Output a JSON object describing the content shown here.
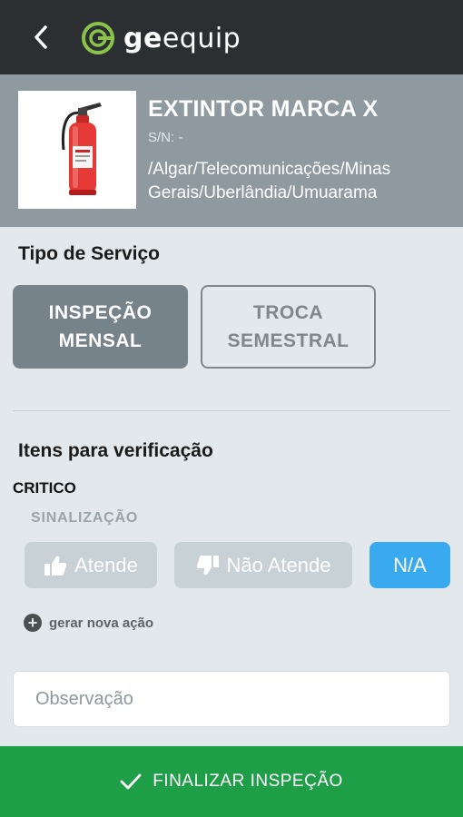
{
  "app": {
    "logo_prefix": "ge",
    "logo_suffix": "equip",
    "back_icon": "chevron-left-icon",
    "brand_color": "#8bc34a"
  },
  "equipment": {
    "name": "EXTINTOR MARCA X",
    "serial": "S/N: -",
    "path": "/Algar/Telecomunicações/Minas Gerais/Uberlândia/Umuarama",
    "image_icon": "fire-extinguisher-icon"
  },
  "service": {
    "title": "Tipo de Serviço",
    "options": [
      {
        "line1": "INSPEÇÃO",
        "line2": "MENSAL",
        "selected": true
      },
      {
        "line1": "TROCA",
        "line2": "SEMESTRAL",
        "selected": false
      }
    ]
  },
  "verification": {
    "title": "Itens para verificação",
    "group": "CRITICO",
    "item": "SINALIZAÇÃO",
    "answers": {
      "attend": "Atende",
      "not_attend": "Não Atende",
      "na": "N/A",
      "selected": "N/A"
    },
    "new_action": "gerar nova ação",
    "observation_placeholder": "Observação"
  },
  "footer": {
    "finish_label": "FINALIZAR INSPEÇÃO"
  },
  "colors": {
    "topbar": "#2b2f32",
    "header": "#8f9aa0",
    "content": "#e2e8eb",
    "selected_blue": "#39a9f0",
    "finish_green": "#1f9e48"
  }
}
